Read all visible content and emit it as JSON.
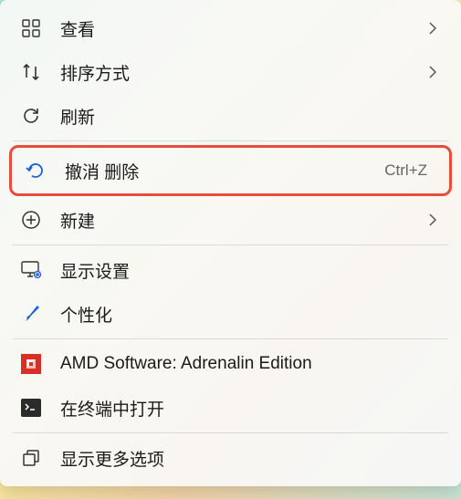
{
  "menu": {
    "groups": [
      [
        {
          "id": "view",
          "icon": "grid-icon",
          "label": "查看",
          "hasSubmenu": true
        },
        {
          "id": "sort",
          "icon": "sort-icon",
          "label": "排序方式",
          "hasSubmenu": true
        },
        {
          "id": "refresh",
          "icon": "refresh-icon",
          "label": "刷新"
        }
      ],
      [
        {
          "id": "undo-delete",
          "icon": "undo-icon",
          "label": "撤消 删除",
          "shortcut": "Ctrl+Z",
          "highlighted": true
        },
        {
          "id": "new",
          "icon": "plus-circle-icon",
          "label": "新建",
          "hasSubmenu": true
        }
      ],
      [
        {
          "id": "display-settings",
          "icon": "display-gear-icon",
          "label": "显示设置"
        },
        {
          "id": "personalize",
          "icon": "brush-icon",
          "label": "个性化"
        }
      ],
      [
        {
          "id": "amd",
          "icon": "amd-icon",
          "label": "AMD Software: Adrenalin Edition"
        },
        {
          "id": "terminal",
          "icon": "terminal-icon",
          "label": "在终端中打开"
        }
      ],
      [
        {
          "id": "more-options",
          "icon": "more-options-icon",
          "label": "显示更多选项"
        }
      ]
    ]
  }
}
